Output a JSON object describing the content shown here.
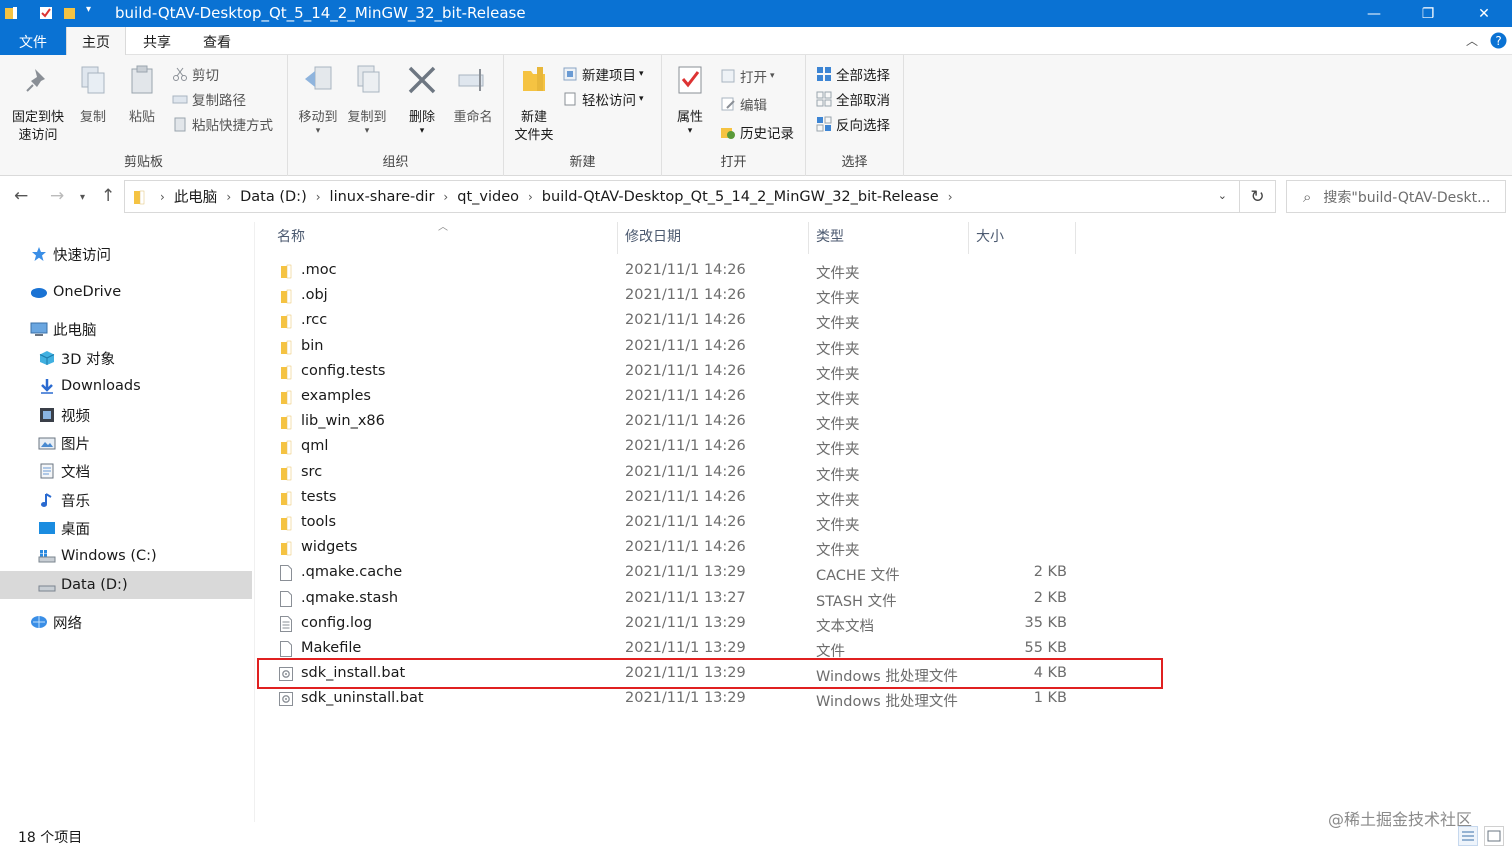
{
  "window": {
    "title": "build-QtAV-Desktop_Qt_5_14_2_MinGW_32_bit-Release",
    "minimize": "—",
    "maximize": "❐",
    "close": "✕"
  },
  "tabs": {
    "file": "文件",
    "home": "主页",
    "share": "共享",
    "view": "查看"
  },
  "ribbon": {
    "clipboard": {
      "label": "剪贴板",
      "pin_line1": "固定到快",
      "pin_line2": "速访问",
      "copy": "复制",
      "paste": "粘贴",
      "cut": "剪切",
      "copy_path": "复制路径",
      "paste_shortcut": "粘贴快捷方式"
    },
    "organize": {
      "label": "组织",
      "move_to": "移动到",
      "copy_to": "复制到",
      "delete": "删除",
      "rename": "重命名"
    },
    "new": {
      "label": "新建",
      "new_folder_line1": "新建",
      "new_folder_line2": "文件夹",
      "new_item": "新建项目",
      "easy_access": "轻松访问"
    },
    "open": {
      "label": "打开",
      "properties": "属性",
      "open": "打开",
      "edit": "编辑",
      "history": "历史记录"
    },
    "select": {
      "label": "选择",
      "select_all": "全部选择",
      "select_none": "全部取消",
      "invert": "反向选择"
    }
  },
  "address": {
    "crumbs": [
      "此电脑",
      "Data (D:)",
      "linux-share-dir",
      "qt_video",
      "build-QtAV-Desktop_Qt_5_14_2_MinGW_32_bit-Release"
    ],
    "search_placeholder": "搜索\"build-QtAV-Deskt..."
  },
  "sidebar": {
    "items": [
      {
        "label": "快速访问",
        "icon": "star-icon"
      },
      {
        "label": "OneDrive",
        "icon": "cloud-icon"
      },
      {
        "label": "此电脑",
        "icon": "computer-icon"
      },
      {
        "label": "3D 对象",
        "icon": "cube-icon"
      },
      {
        "label": "Downloads",
        "icon": "download-icon"
      },
      {
        "label": "视频",
        "icon": "video-icon"
      },
      {
        "label": "图片",
        "icon": "picture-icon"
      },
      {
        "label": "文档",
        "icon": "document-icon"
      },
      {
        "label": "音乐",
        "icon": "music-icon"
      },
      {
        "label": "桌面",
        "icon": "desktop-icon"
      },
      {
        "label": "Windows (C:)",
        "icon": "drive-icon"
      },
      {
        "label": "Data (D:)",
        "icon": "drive-icon"
      },
      {
        "label": "网络",
        "icon": "network-icon"
      }
    ]
  },
  "columns": {
    "name": "名称",
    "date": "修改日期",
    "type": "类型",
    "size": "大小"
  },
  "files": [
    {
      "name": ".moc",
      "date": "2021/11/1 14:26",
      "type": "文件夹",
      "size": "",
      "kind": "folder"
    },
    {
      "name": ".obj",
      "date": "2021/11/1 14:26",
      "type": "文件夹",
      "size": "",
      "kind": "folder"
    },
    {
      "name": ".rcc",
      "date": "2021/11/1 14:26",
      "type": "文件夹",
      "size": "",
      "kind": "folder"
    },
    {
      "name": "bin",
      "date": "2021/11/1 14:26",
      "type": "文件夹",
      "size": "",
      "kind": "folder"
    },
    {
      "name": "config.tests",
      "date": "2021/11/1 14:26",
      "type": "文件夹",
      "size": "",
      "kind": "folder"
    },
    {
      "name": "examples",
      "date": "2021/11/1 14:26",
      "type": "文件夹",
      "size": "",
      "kind": "folder"
    },
    {
      "name": "lib_win_x86",
      "date": "2021/11/1 14:26",
      "type": "文件夹",
      "size": "",
      "kind": "folder"
    },
    {
      "name": "qml",
      "date": "2021/11/1 14:26",
      "type": "文件夹",
      "size": "",
      "kind": "folder"
    },
    {
      "name": "src",
      "date": "2021/11/1 14:26",
      "type": "文件夹",
      "size": "",
      "kind": "folder"
    },
    {
      "name": "tests",
      "date": "2021/11/1 14:26",
      "type": "文件夹",
      "size": "",
      "kind": "folder"
    },
    {
      "name": "tools",
      "date": "2021/11/1 14:26",
      "type": "文件夹",
      "size": "",
      "kind": "folder"
    },
    {
      "name": "widgets",
      "date": "2021/11/1 14:26",
      "type": "文件夹",
      "size": "",
      "kind": "folder"
    },
    {
      "name": ".qmake.cache",
      "date": "2021/11/1 13:29",
      "type": "CACHE 文件",
      "size": "2 KB",
      "kind": "file"
    },
    {
      "name": ".qmake.stash",
      "date": "2021/11/1 13:27",
      "type": "STASH 文件",
      "size": "2 KB",
      "kind": "file"
    },
    {
      "name": "config.log",
      "date": "2021/11/1 13:29",
      "type": "文本文档",
      "size": "35 KB",
      "kind": "text"
    },
    {
      "name": "Makefile",
      "date": "2021/11/1 13:29",
      "type": "文件",
      "size": "55 KB",
      "kind": "file"
    },
    {
      "name": "sdk_install.bat",
      "date": "2021/11/1 13:29",
      "type": "Windows 批处理文件",
      "size": "4 KB",
      "kind": "bat"
    },
    {
      "name": "sdk_uninstall.bat",
      "date": "2021/11/1 13:29",
      "type": "Windows 批处理文件",
      "size": "1 KB",
      "kind": "bat"
    }
  ],
  "status": {
    "count": "18 个项目"
  },
  "watermark": "@稀土掘金技术社区",
  "colors": {
    "accent": "#0a72d3",
    "highlight": "#e02020",
    "folder": "#f5c342"
  }
}
